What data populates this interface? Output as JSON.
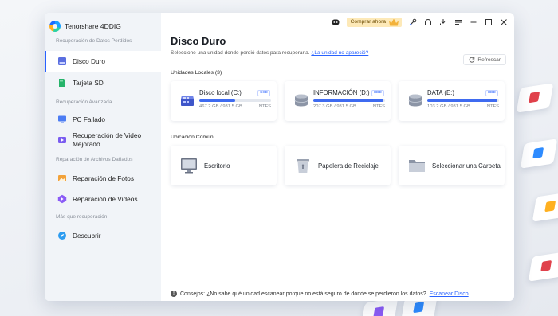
{
  "app": {
    "title": "Tenorshare 4DDIG"
  },
  "sidebar": {
    "sections": [
      {
        "title": "Recuperación de Datos Perdidos",
        "items": [
          {
            "label": "Disco Duro",
            "icon": "hard-drive-icon",
            "active": true
          },
          {
            "label": "Tarjeta SD",
            "icon": "sd-card-icon",
            "active": false
          }
        ]
      },
      {
        "title": "Recuperación Avanzada",
        "items": [
          {
            "label": "PC Fallado",
            "icon": "crashed-pc-icon",
            "active": false
          },
          {
            "label": "Recuperación de Video Mejorado",
            "icon": "video-recovery-icon",
            "active": false
          }
        ]
      },
      {
        "title": "Reparación de Archivos Dañados",
        "items": [
          {
            "label": "Reparación de Fotos",
            "icon": "photo-repair-icon",
            "active": false
          },
          {
            "label": "Reparación de Videos",
            "icon": "video-repair-icon",
            "active": false
          }
        ]
      },
      {
        "title": "Más que recuperación",
        "items": [
          {
            "label": "Descubrir",
            "icon": "discover-icon",
            "active": false
          }
        ]
      }
    ]
  },
  "titlebar": {
    "buy_label": "Comprar ahora",
    "icons": [
      "discord-icon",
      "buy-crown-icon",
      "wrench-icon",
      "headset-icon",
      "download-icon",
      "menu-icon",
      "minimize-icon",
      "maximize-icon",
      "close-icon"
    ]
  },
  "main": {
    "title": "Disco Duro",
    "subtitle": "Seleccione una unidad donde perdió datos para recuperarla.",
    "subtitle_link": "¿La unidad no apareció?",
    "refresh_label": "Refrescar",
    "local_units_label": "Unidades Locales (3)",
    "drives": [
      {
        "name": "Disco local (C:)",
        "tag": "SSD",
        "used": "467.2 GB / 931.5 GB",
        "fs": "NTFS",
        "usage": 0.5
      },
      {
        "name": "INFORMACIÓN (D:)",
        "tag": "HDD",
        "used": "207.3 GB / 931.5 GB",
        "fs": "NTFS",
        "usage": 0.98
      },
      {
        "name": "DATA (E:)",
        "tag": "HDD",
        "used": "103.2 GB / 931.5 GB",
        "fs": "NTFS",
        "usage": 0.98
      }
    ],
    "common_location_label": "Ubicación Común",
    "locations": [
      {
        "label": "Escritorio",
        "icon": "desktop-icon"
      },
      {
        "label": "Papelera de Reciclaje",
        "icon": "recycle-bin-icon"
      },
      {
        "label": "Seleccionar una Carpeta",
        "icon": "folder-icon"
      }
    ],
    "tip_text": "Consejos: ¿No sabe qué unidad escanear porque no está seguro de dónde se perdieron los datos?",
    "tip_link": "Escanear Disco"
  },
  "colors": {
    "accent": "#2962ff",
    "bar_fill": "#3f6bf0",
    "sidebar_bg": "#f1f4f8",
    "buy_bg": "#fde9b8"
  }
}
